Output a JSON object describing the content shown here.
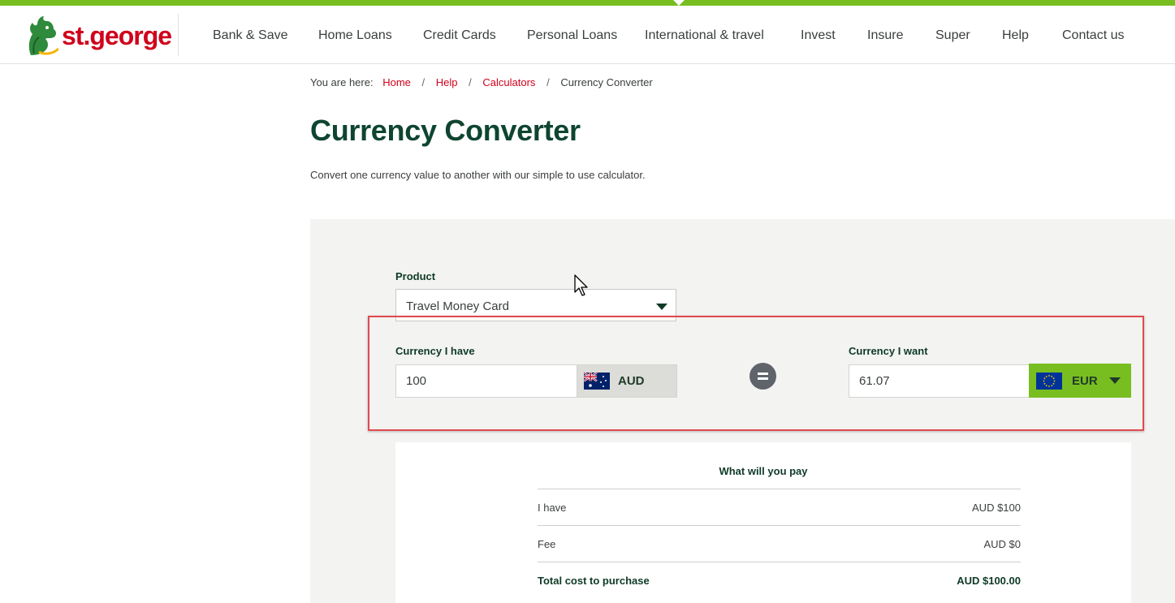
{
  "brand": {
    "name": "st.george"
  },
  "nav": {
    "items": [
      "Bank & Save",
      "Home Loans",
      "Credit Cards",
      "Personal Loans",
      "International & travel",
      "Invest",
      "Insure",
      "Super",
      "Help",
      "Contact us"
    ]
  },
  "breadcrumb": {
    "prefix": "You are here:",
    "items": [
      "Home",
      "Help",
      "Calculators",
      "Currency Converter"
    ],
    "separator": "/"
  },
  "page": {
    "title": "Currency Converter",
    "intro": "Convert one currency value to another with our simple to use calculator."
  },
  "converter": {
    "product_label": "Product",
    "product_value": "Travel Money Card",
    "have_label": "Currency I have",
    "have_amount": "100",
    "have_currency": "AUD",
    "want_label": "Currency I want",
    "want_amount": "61.07",
    "want_currency": "EUR"
  },
  "summary": {
    "title": "What will you pay",
    "rows": [
      {
        "label": "I have",
        "value": "AUD $100"
      },
      {
        "label": "Fee",
        "value": "AUD $0"
      },
      {
        "label": "Total cost to purchase",
        "value": "AUD $100.00"
      }
    ]
  },
  "colors": {
    "brand_green": "#78be20",
    "brand_red": "#d0021b",
    "heading_green": "#0e4530",
    "highlight_red": "#e04a4f"
  },
  "icons": [
    "dragon-logo-icon",
    "chevron-down-icon",
    "australia-flag-icon",
    "eu-flag-icon",
    "equals-icon",
    "mouse-cursor-icon"
  ]
}
